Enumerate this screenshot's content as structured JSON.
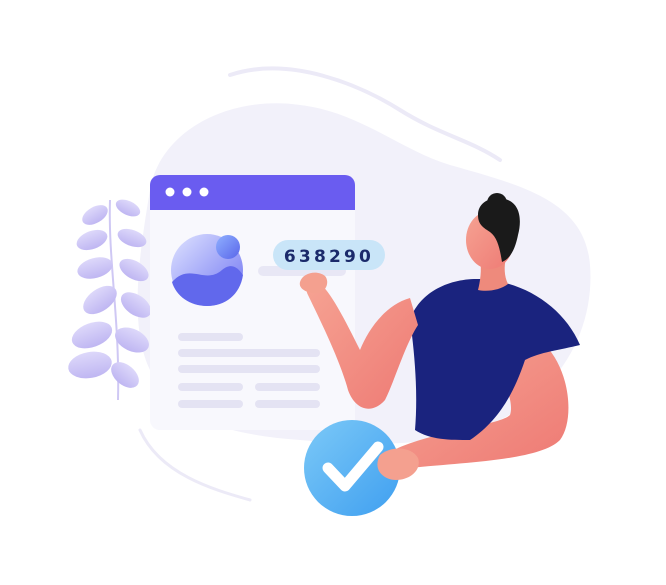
{
  "verification": {
    "code": "638290"
  },
  "colors": {
    "blob_background": "#f1f0fa",
    "browser_header": "#6a5cf0",
    "browser_window": "#f8f8fc",
    "placeholder_text": "#e4e3f3",
    "image_placeholder": "#7b7ff5",
    "code_bubble": "#c9e5f8",
    "code_text": "#1b2a6b",
    "leaves": "#c9c2f5",
    "shirt": "#1a237e",
    "skin": "#f28b82",
    "hair": "#1a1a1a",
    "checkmark_circle": "#5eb8f5"
  },
  "icons": {
    "browser_dots": "window-control-dots",
    "image_placeholder": "image-icon",
    "check": "checkmark-icon",
    "plant": "leaf-decoration"
  }
}
